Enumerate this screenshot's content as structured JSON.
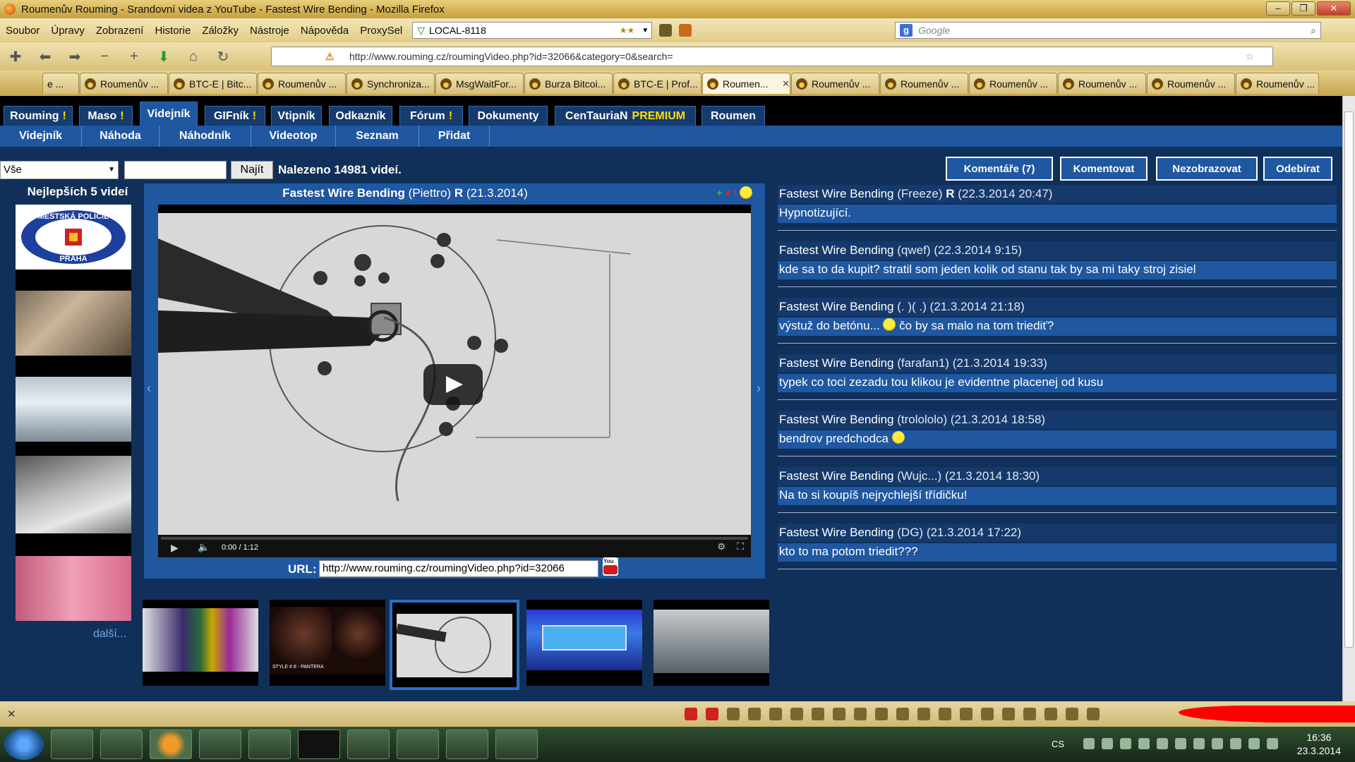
{
  "window": {
    "title": "Roumenův Rouming - Srandovní videa z YouTube - Fastest Wire Bending - Mozilla Firefox",
    "buttons": [
      "–",
      "❐",
      "✕"
    ]
  },
  "menubar": {
    "items": [
      "Soubor",
      "Úpravy",
      "Zobrazení",
      "Historie",
      "Záložky",
      "Nástroje",
      "Nápověda",
      "ProxySel"
    ],
    "proxy_value": "LOCAL-8118",
    "proxy_stars": "★★",
    "search_placeholder": "Google"
  },
  "navbar": {
    "url": "http://www.rouming.cz/roumingVideo.php?id=32066&category=0&search="
  },
  "tabs": [
    {
      "label": "e ...",
      "active": false
    },
    {
      "label": "Roumenův ...",
      "active": false
    },
    {
      "label": "BTC-E | Bitc...",
      "active": false
    },
    {
      "label": "Roumenův ...",
      "active": false
    },
    {
      "label": "Synchroniza...",
      "active": false
    },
    {
      "label": "MsgWaitFor...",
      "active": false
    },
    {
      "label": "Burza Bitcoi...",
      "active": false
    },
    {
      "label": "BTC-E | Prof...",
      "active": false
    },
    {
      "label": "Roumen...",
      "active": true
    },
    {
      "label": "Roumenův ...",
      "active": false
    },
    {
      "label": "Roumenův ...",
      "active": false
    },
    {
      "label": "Roumenův ...",
      "active": false
    },
    {
      "label": "Roumenův ...",
      "active": false
    },
    {
      "label": "Roumenův ...",
      "active": false
    },
    {
      "label": "Roumenův ...",
      "active": false
    }
  ],
  "site": {
    "main_nav": [
      {
        "label": "Rouming",
        "bang": "!"
      },
      {
        "label": "Maso",
        "bang": "!"
      },
      {
        "label": "Videjník",
        "bang": ""
      },
      {
        "label": "GIFník",
        "bang": "!"
      },
      {
        "label": "Vtipník",
        "bang": ""
      },
      {
        "label": "Odkazník",
        "bang": ""
      },
      {
        "label": "Fórum",
        "bang": "!"
      },
      {
        "label": "Dokumenty",
        "bang": ""
      },
      {
        "label": "CenTauriaN",
        "bang": "PREMIUM"
      },
      {
        "label": "Roumen",
        "bang": ""
      }
    ],
    "sub_nav": [
      "Videjník",
      "Náhoda",
      "Náhodník",
      "Videotop",
      "Seznam",
      "Přidat"
    ],
    "filter": {
      "category": "Vše",
      "search_value": "",
      "find_label": "Najít",
      "found_text": "Nalezeno 14981 videí."
    },
    "actions": {
      "comments": "Komentáře (7)",
      "comment": "Komentovat",
      "hide": "Nezobrazovat",
      "subscribe": "Odebírat"
    },
    "best": {
      "title": "Nejlepších 5 videí",
      "badge_top": "MĚSTSKÁ POLICIE",
      "badge_bottom": "PRAHA",
      "more": "další..."
    },
    "video": {
      "title": "Fastest Wire Bending",
      "author": "(Piettro)",
      "flag": "R",
      "date": "(21.3.2014)",
      "time": "0:00 / 1:12",
      "url_label": "URL:",
      "share_url": "http://www.rouming.cz/roumingVideo.php?id=32066",
      "yt_label": "You"
    },
    "related_caption": "STYLE # 8 - PANTERA",
    "comments": [
      {
        "title": "Fastest Wire Bending",
        "author": "(Freeze)",
        "flag": "R",
        "date": "(22.3.2014 20:47)",
        "text": "Hypnotizující.",
        "smiley": ""
      },
      {
        "title": "Fastest Wire Bending",
        "author": "(qwef)",
        "flag": "",
        "date": "(22.3.2014 9:15)",
        "text": "kde sa to da kupit? stratil som jeden kolik od stanu tak by sa mi taky stroj zisiel",
        "smiley": ""
      },
      {
        "title": "Fastest Wire Bending",
        "author": "(. )( .)",
        "flag": "",
        "date": "(21.3.2014 21:18)",
        "text": "výstuž do betónu...",
        "smiley": "čo by sa malo na tom triediť?"
      },
      {
        "title": "Fastest Wire Bending",
        "author": "(farafan1)",
        "flag": "",
        "date": "(21.3.2014 19:33)",
        "text": "typek co toci zezadu tou klikou je evidentne placenej od kusu",
        "smiley": ""
      },
      {
        "title": "Fastest Wire Bending",
        "author": "(trolololo)",
        "flag": "",
        "date": "(21.3.2014 18:58)",
        "text": "bendrov predchodca",
        "smiley": " "
      },
      {
        "title": "Fastest Wire Bending",
        "author": "(Wujc...)",
        "flag": "",
        "date": "(21.3.2014 18:30)",
        "text": "Na to si koupíš nejrychlejší třídičku!",
        "smiley": ""
      },
      {
        "title": "Fastest Wire Bending",
        "author": "(DG)",
        "flag": "",
        "date": "(21.3.2014 17:22)",
        "text": "kto to ma potom triedit???",
        "smiley": ""
      }
    ]
  },
  "taskbar": {
    "lang": "CS",
    "time": "16:36",
    "date": "23.3.2014"
  },
  "colors": {
    "site_bg": "#10305a",
    "nav_blue": "#1f57a0",
    "premium_yellow": "#ffde00"
  }
}
